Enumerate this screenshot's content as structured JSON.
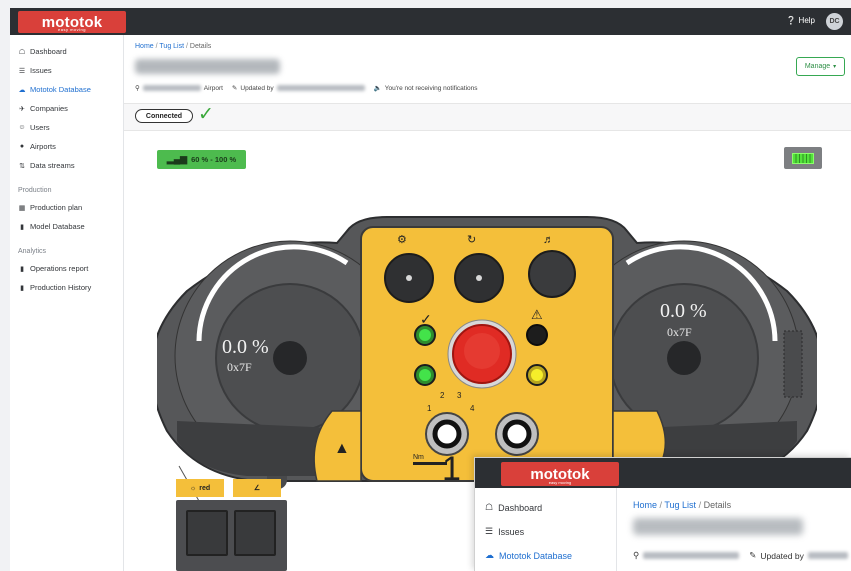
{
  "app": {
    "brand": "mototok",
    "brand_tagline": "easy moving",
    "help_label": "Help",
    "avatar_initials": "DC"
  },
  "sidebar": {
    "items": [
      {
        "label": "Dashboard",
        "icon": "dashboard-icon"
      },
      {
        "label": "Issues",
        "icon": "list-icon"
      },
      {
        "label": "Mototok Database",
        "icon": "cloud-icon",
        "active": true
      },
      {
        "label": "Companies",
        "icon": "plane-icon"
      },
      {
        "label": "Users",
        "icon": "user-icon"
      },
      {
        "label": "Airports",
        "icon": "map-marker-icon"
      },
      {
        "label": "Data streams",
        "icon": "stream-icon"
      }
    ],
    "sections": [
      {
        "title": "Production",
        "items": [
          {
            "label": "Production plan",
            "icon": "calendar-icon"
          },
          {
            "label": "Model Database",
            "icon": "database-icon"
          }
        ]
      },
      {
        "title": "Analytics",
        "items": [
          {
            "label": "Operations report",
            "icon": "report-icon"
          },
          {
            "label": "Production History",
            "icon": "history-icon"
          }
        ]
      }
    ]
  },
  "main": {
    "breadcrumb": {
      "home": "Home",
      "list": "Tug List",
      "current": "Details"
    },
    "meta": {
      "airport_suffix": "Airport",
      "updated_by": "Updated by",
      "notifications": "You're not receiving notifications"
    },
    "manage_label": "Manage",
    "connection_label": "Connected"
  },
  "controller": {
    "signal_label": "60 % - 100 %",
    "left_gauge": {
      "value": "0.0 %",
      "hex": "0x7F"
    },
    "right_gauge": {
      "value": "0.0 %",
      "hex": "0x7F"
    },
    "selector_numbers": [
      "1",
      "2",
      "3",
      "4"
    ],
    "torque_label": "Nm",
    "aux_buttons": [
      "red",
      ""
    ]
  },
  "overlay": {
    "step_number": "1",
    "brand": "mototok",
    "brand_tagline": "easy moving",
    "items": [
      {
        "label": "Dashboard",
        "icon": "dashboard-icon"
      },
      {
        "label": "Issues",
        "icon": "list-icon"
      },
      {
        "label": "Mototok Database",
        "icon": "cloud-icon",
        "active": true
      }
    ],
    "breadcrumb": {
      "home": "Home",
      "list": "Tug List",
      "current": "Details"
    },
    "updated_by": "Updated by"
  },
  "colors": {
    "brand_red": "#d9403a",
    "topbar": "#2c2f33",
    "accent_blue": "#1f6fd0",
    "signal_green": "#4dbb4e",
    "panel_yellow": "#f4bf3a",
    "body_grey": "#565759"
  }
}
